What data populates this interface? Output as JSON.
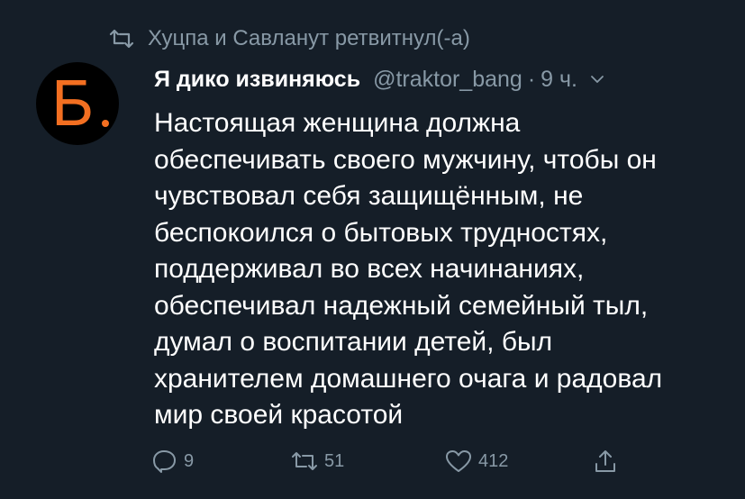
{
  "retweet": {
    "icon": "retweet-icon",
    "text": "Хуцпа и Савланут ретвитнул(-а)"
  },
  "author": {
    "avatar_letter": "Б",
    "avatar_letter_color": "#f36f21",
    "avatar_bg": "#000000",
    "display_name": "Я дико извиняюсь",
    "handle": "@traktor_bang",
    "separator": "·",
    "time": "9 ч."
  },
  "tweet": {
    "text": "Настоящая женщина должна\nобеспечивать своего мужчину, чтобы он\nчувствовал себя защищённым, не\nбеспокоился о бытовых трудностях,\nподдерживал во всех начинаниях,\nобеспечивал надежный семейный тыл,\nдумал о воспитании детей, был\nхранителем домашнего очага и радовал\nмир своей красотой"
  },
  "actions": {
    "reply": {
      "icon": "reply-icon",
      "count": "9"
    },
    "retweet": {
      "icon": "retweet-icon",
      "count": "51"
    },
    "like": {
      "icon": "heart-icon",
      "count": "412"
    },
    "share": {
      "icon": "share-icon"
    }
  },
  "colors": {
    "background": "#151e28",
    "text": "#ffffff",
    "muted": "#8899a6"
  }
}
